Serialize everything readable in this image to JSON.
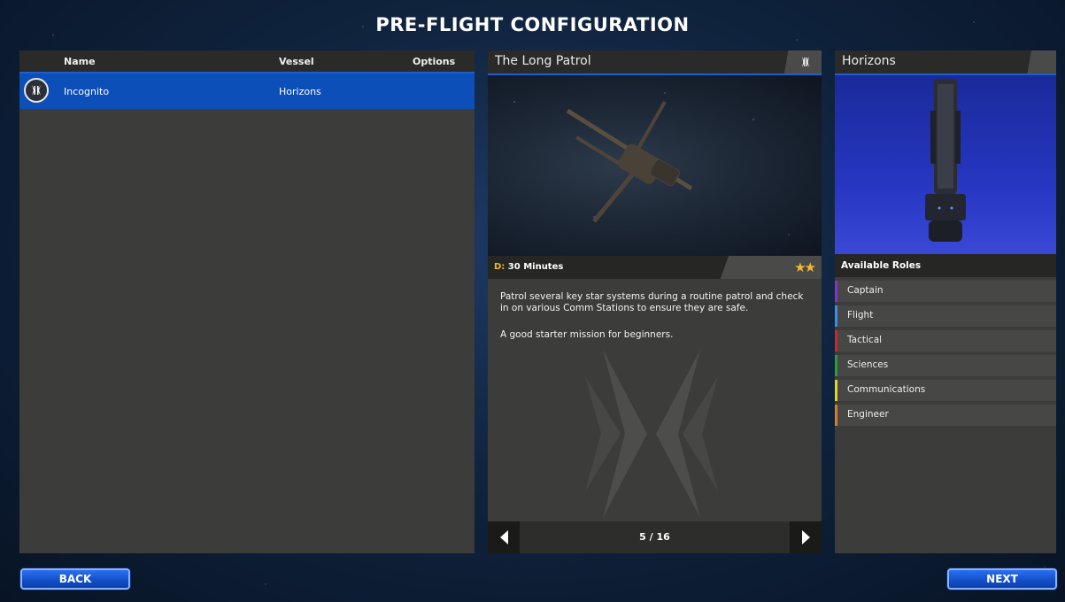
{
  "screen": {
    "title": "PRE-FLIGHT CONFIGURATION"
  },
  "crew_list": {
    "columns": {
      "name": "Name",
      "vessel": "Vessel",
      "options": "Options"
    },
    "rows": [
      {
        "name": "Incognito",
        "vessel": "Horizons",
        "emblem": "faction-emblem-icon"
      }
    ]
  },
  "mission": {
    "title": "The Long Patrol",
    "duration_label": "D:",
    "duration": "30 Minutes",
    "difficulty_stars": 2,
    "description": [
      "Patrol several key star systems during a routine patrol and check in on various Comm Stations to ensure they are safe.",
      "A good starter mission for beginners."
    ],
    "pager": {
      "current": "5",
      "total": "16",
      "display": "5 / 16"
    }
  },
  "vessel": {
    "name": "Horizons",
    "roles_title": "Available Roles",
    "roles": [
      {
        "label": "Captain",
        "color": "#8b2fc9"
      },
      {
        "label": "Flight",
        "color": "#3a8fe0"
      },
      {
        "label": "Tactical",
        "color": "#d42424"
      },
      {
        "label": "Sciences",
        "color": "#2aa02a"
      },
      {
        "label": "Communications",
        "color": "#e8d21a"
      },
      {
        "label": "Engineer",
        "color": "#e07a1a"
      }
    ]
  },
  "buttons": {
    "back": "BACK",
    "next": "NEXT"
  },
  "colors": {
    "accent": "#1c5fd0",
    "selected_row": "#0d4fb8",
    "panel": "#3c3c3a",
    "star": "#f2b833"
  }
}
